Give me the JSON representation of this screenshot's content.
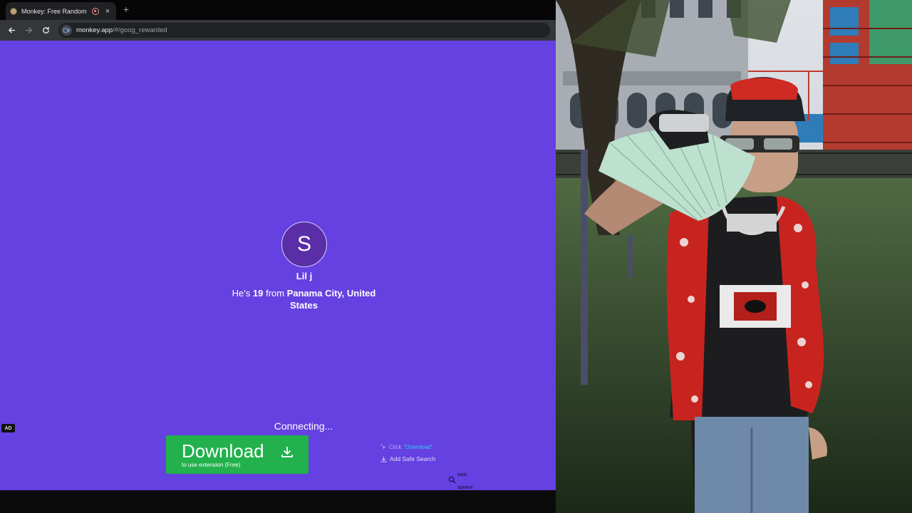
{
  "browser": {
    "tab_title": "Monkey: Free Random Vide",
    "tab_close": "×",
    "new_tab": "+",
    "url_host": "monkey.app",
    "url_path": "/#/goog_rewarded"
  },
  "profile": {
    "initial": "S",
    "name": "Lil j",
    "prefix": "He's ",
    "age": "19",
    "from_text": " from ",
    "location": "Panama City, United States"
  },
  "status_text": "Connecting...",
  "ad": {
    "badge": "AD",
    "download_label": "Download",
    "download_sub": "to use extension (Free)",
    "hint_click": "Click",
    "hint_click_highlight": "\"Download\"",
    "hint_add": "Add Safe Search",
    "logo_line1": "SAFE",
    "logo_line2": "SEARCH"
  },
  "colors": {
    "page_bg": "#6441e0",
    "download_green": "#22b14c",
    "avatar_bg": "#5a2ea6"
  }
}
